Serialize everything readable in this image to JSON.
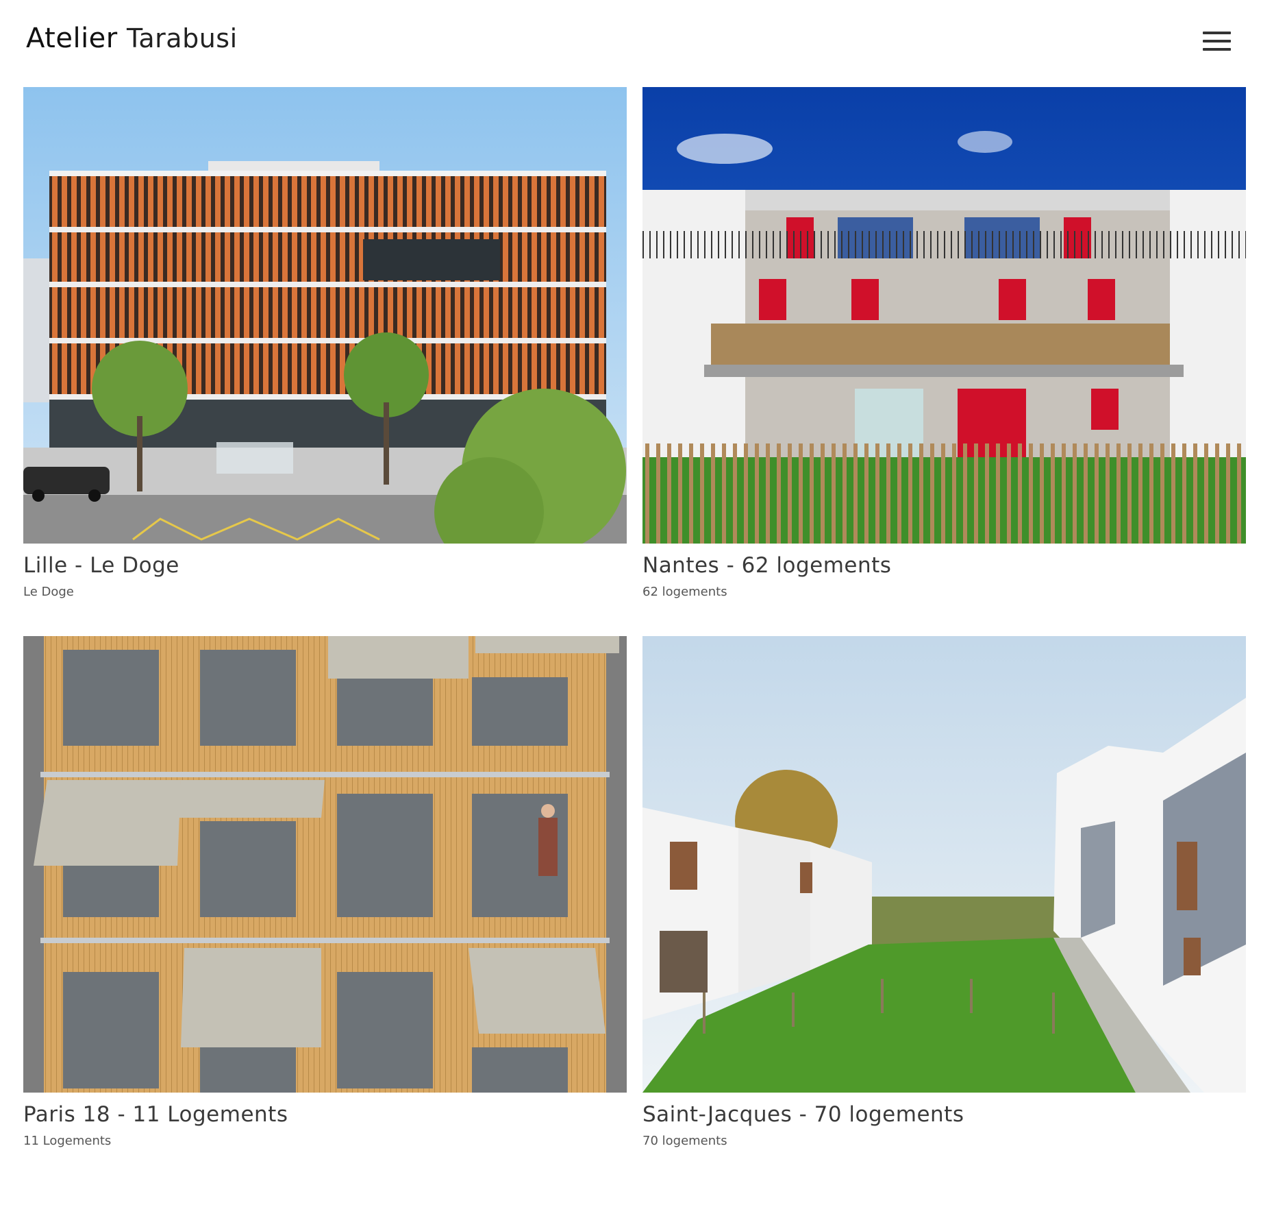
{
  "site": {
    "logo_first": "Atelier",
    "logo_second": "Tarabusi",
    "menu_icon": "hamburger-menu-icon"
  },
  "projects": [
    {
      "title": "Lille - Le Doge",
      "subtitle": "Le Doge"
    },
    {
      "title": "Nantes - 62 logements",
      "subtitle": "62 logements"
    },
    {
      "title": "Paris 18 - 11 Logements",
      "subtitle": "11 Logements"
    },
    {
      "title": "Saint-Jacques - 70 logements",
      "subtitle": "70 logements"
    }
  ]
}
